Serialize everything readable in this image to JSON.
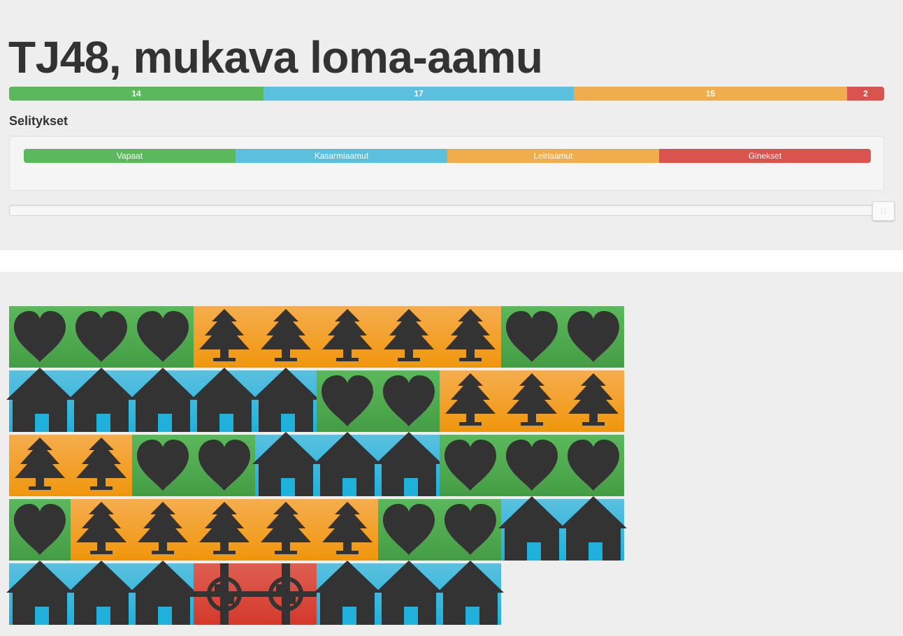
{
  "page_title": "TJ48, mukava loma-aamu",
  "summary": {
    "segments": [
      {
        "label": "14",
        "value": 14,
        "color": "#5cb85c"
      },
      {
        "label": "17",
        "value": 17,
        "color": "#5bc0de"
      },
      {
        "label": "15",
        "value": 15,
        "color": "#f0ad4e"
      },
      {
        "label": "2",
        "value": 2,
        "color": "#d9534f"
      }
    ]
  },
  "legend": {
    "title": "Selitykset",
    "items": [
      {
        "label": "Vapaat",
        "icon": "heart-icon",
        "color": "#5cb85c"
      },
      {
        "label": "Kasarmiaamut",
        "icon": "house-icon",
        "color": "#5bc0de"
      },
      {
        "label": "Leiriaamut",
        "icon": "tree-icon",
        "color": "#f0ad4e"
      },
      {
        "label": "Ginekset",
        "icon": "crosshair-icon",
        "color": "#d9534f"
      }
    ]
  },
  "slider": {
    "value_fraction": 1.0
  },
  "calendar": {
    "rows": [
      [
        "heart",
        "heart",
        "heart",
        "tree",
        "tree",
        "tree",
        "tree",
        "tree",
        "heart",
        "heart"
      ],
      [
        "house",
        "house",
        "house",
        "house",
        "house",
        "heart",
        "heart",
        "tree",
        "tree",
        "tree"
      ],
      [
        "tree",
        "tree",
        "heart",
        "heart",
        "house",
        "house",
        "house",
        "heart",
        "heart",
        "heart"
      ],
      [
        "heart",
        "tree",
        "tree",
        "tree",
        "tree",
        "tree",
        "heart",
        "heart",
        "house",
        "house"
      ],
      [
        "house",
        "house",
        "house",
        "target",
        "target",
        "house",
        "house",
        "house"
      ]
    ]
  }
}
